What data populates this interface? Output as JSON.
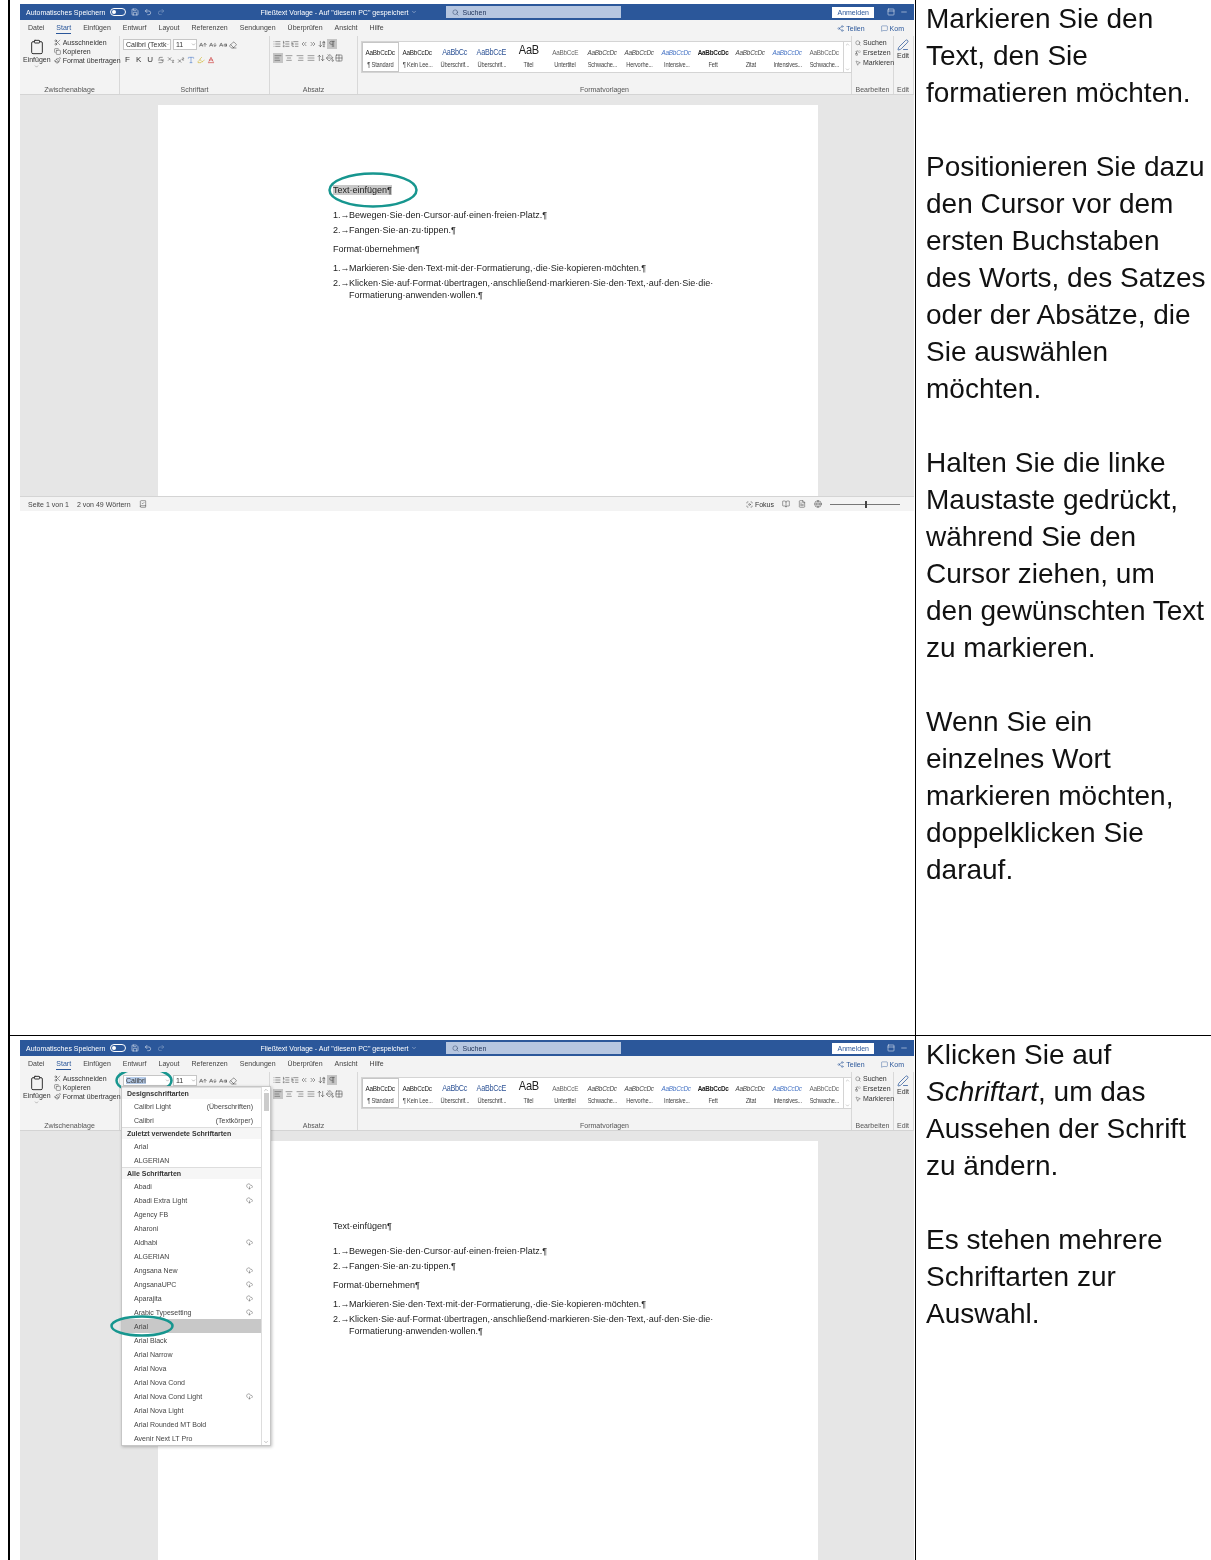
{
  "rows": [
    {
      "screenshot": {
        "title_bar": {
          "autosave_label": "Automatisches Speichern",
          "autosave_on": false,
          "document_title": "Fließtext Vorlage - Auf \"diesem PC\" gespeichert",
          "search_placeholder": "Suchen",
          "sign_in": "Anmelden"
        },
        "tabs": [
          {
            "label": "Datei",
            "selected": false
          },
          {
            "label": "Start",
            "selected": true
          },
          {
            "label": "Einfügen",
            "selected": false
          },
          {
            "label": "Entwurf",
            "selected": false
          },
          {
            "label": "Layout",
            "selected": false
          },
          {
            "label": "Referenzen",
            "selected": false
          },
          {
            "label": "Sendungen",
            "selected": false
          },
          {
            "label": "Überprüfen",
            "selected": false
          },
          {
            "label": "Ansicht",
            "selected": false
          },
          {
            "label": "Hilfe",
            "selected": false
          }
        ],
        "share_label": "Teilen",
        "comments_label": "Kom",
        "clipboard": {
          "paste": "Einfügen",
          "cut": "Ausschneiden",
          "copy": "Kopieren",
          "format_painter": "Format übertragen",
          "group": "Zwischenablage"
        },
        "font": {
          "name": "Calibri (Textk",
          "name_selected": false,
          "circled": false,
          "size": "11",
          "buttons": [
            "F",
            "K",
            "U"
          ],
          "group": "Schriftart"
        },
        "paragraph": {
          "show_marks": true,
          "alignments": [
            {
              "kind": "left",
              "selected": true
            },
            {
              "kind": "center",
              "selected": false
            },
            {
              "kind": "right",
              "selected": false
            },
            {
              "kind": "justify",
              "selected": false
            }
          ],
          "group": "Absatz"
        },
        "styles": {
          "group": "Formatvorlagen",
          "items": [
            {
              "preview": "AaBbCcDc",
              "name": "¶ Standard",
              "kind": "normal",
              "selected": true
            },
            {
              "preview": "AaBbCcDc",
              "name": "¶ Kein Lee...",
              "kind": "normal",
              "selected": false
            },
            {
              "preview": "AaBbCc",
              "name": "Überschrif...",
              "kind": "heading",
              "selected": false
            },
            {
              "preview": "AaBbCcE",
              "name": "Überschrif...",
              "kind": "heading",
              "selected": false
            },
            {
              "preview": "AaB",
              "name": "Titel",
              "kind": "title",
              "selected": false
            },
            {
              "preview": "AaBbCcE",
              "name": "Untertitel",
              "kind": "subtle",
              "selected": false
            },
            {
              "preview": "AaBbCcDc",
              "name": "Schwache...",
              "kind": "emphasis",
              "selected": false
            },
            {
              "preview": "AaBbCcDc",
              "name": "Hervorhe...",
              "kind": "emphasis",
              "selected": false
            },
            {
              "preview": "AaBbCcDc",
              "name": "Intensive...",
              "kind": "intense",
              "selected": false
            },
            {
              "preview": "AaBbCcDc",
              "name": "Fett",
              "kind": "strong",
              "selected": false
            },
            {
              "preview": "AaBbCcDc",
              "name": "Zitat",
              "kind": "emphasis",
              "selected": false
            },
            {
              "preview": "AaBbCcDc",
              "name": "Intensives...",
              "kind": "intense",
              "selected": false
            },
            {
              "preview": "AaBbCcDc",
              "name": "Schwache...",
              "kind": "subtle",
              "selected": false
            }
          ]
        },
        "editing": {
          "find": "Suchen",
          "replace": "Ersetzen",
          "select": "Markieren",
          "group": "Bearbeiten"
        },
        "editor": {
          "label": "Edit",
          "group": "Edit"
        },
        "document": {
          "heading": {
            "text": "Text·einfügen¶",
            "selected": true,
            "circled": true
          },
          "list_1": [
            {
              "number": "1.→",
              "text": "Bewegen·Sie·den·Cursor·auf·einen·freien·Platz.¶"
            },
            {
              "number": "2.→",
              "text": "Fangen·Sie·an·zu·tippen.¶"
            }
          ],
          "subheading": "Format·übernehmen¶",
          "list_2": [
            {
              "number": "1.→",
              "text": "Markieren·Sie·den·Text·mit·der·Formatierung,·die·Sie·kopieren·möchten.¶"
            },
            {
              "number": "2.→",
              "text": "Klicken·Sie·auf·Format·übertragen,·anschließend·markieren·Sie·den·Text,·auf·den·Sie·die·Formatierung·anwenden·wollen.¶"
            }
          ]
        },
        "status_bar": {
          "page": "Seite 1 von 1",
          "words": "2 von 49 Wörtern",
          "focus": "Fokus",
          "zoom": {
            "level": 0.5
          }
        }
      },
      "instructions": [
        "Markieren Sie den Text, den Sie formatieren möchten.",
        "Positionieren Sie dazu den Cursor vor dem ersten Buchstaben des Worts, des Satzes oder der Absätze, die Sie auswählen möchten.",
        "Halten Sie die linke Maustaste gedrückt, während Sie den Cursor ziehen, um den gewünschten Text zu markieren.",
        "Wenn Sie ein einzelnes Wort markieren möchten, doppelklicken Sie darauf."
      ]
    },
    {
      "screenshot": {
        "title_bar": {
          "autosave_label": "Automatisches Speichern",
          "autosave_on": false,
          "document_title": "Fließtext Vorlage - Auf \"diesem PC\" gespeichert",
          "search_placeholder": "Suchen",
          "sign_in": "Anmelden"
        },
        "tabs": [
          {
            "label": "Datei",
            "selected": false
          },
          {
            "label": "Start",
            "selected": true
          },
          {
            "label": "Einfügen",
            "selected": false
          },
          {
            "label": "Entwurf",
            "selected": false
          },
          {
            "label": "Layout",
            "selected": false
          },
          {
            "label": "Referenzen",
            "selected": false
          },
          {
            "label": "Sendungen",
            "selected": false
          },
          {
            "label": "Überprüfen",
            "selected": false
          },
          {
            "label": "Ansicht",
            "selected": false
          },
          {
            "label": "Hilfe",
            "selected": false
          }
        ],
        "share_label": "Teilen",
        "comments_label": "Kom",
        "clipboard": {
          "paste": "Einfügen",
          "cut": "Ausschneiden",
          "copy": "Kopieren",
          "format_painter": "Format übertragen",
          "group": "Zwischenablage"
        },
        "font": {
          "name": "Calibri",
          "name_selected": true,
          "circled": true,
          "size": "11"
        },
        "paragraph": {
          "show_marks": true,
          "alignments": [
            {
              "kind": "left",
              "selected": true
            },
            {
              "kind": "center",
              "selected": false
            },
            {
              "kind": "right",
              "selected": false
            },
            {
              "kind": "justify",
              "selected": false
            }
          ],
          "group": "Absatz"
        },
        "styles": {
          "group": "Formatvorlagen",
          "items": [
            {
              "preview": "AaBbCcDc",
              "name": "¶ Standard",
              "kind": "normal",
              "selected": true
            },
            {
              "preview": "AaBbCcDc",
              "name": "¶ Kein Lee...",
              "kind": "normal",
              "selected": false
            },
            {
              "preview": "AaBbCc",
              "name": "Überschrif...",
              "kind": "heading",
              "selected": false
            },
            {
              "preview": "AaBbCcE",
              "name": "Überschrif...",
              "kind": "heading",
              "selected": false
            },
            {
              "preview": "AaB",
              "name": "Titel",
              "kind": "title",
              "selected": false
            },
            {
              "preview": "AaBbCcE",
              "name": "Untertitel",
              "kind": "subtle",
              "selected": false
            },
            {
              "preview": "AaBbCcDc",
              "name": "Schwache...",
              "kind": "emphasis",
              "selected": false
            },
            {
              "preview": "AaBbCcDc",
              "name": "Hervorhe...",
              "kind": "emphasis",
              "selected": false
            },
            {
              "preview": "AaBbCcDc",
              "name": "Intensive...",
              "kind": "intense",
              "selected": false
            },
            {
              "preview": "AaBbCcDc",
              "name": "Fett",
              "kind": "strong",
              "selected": false
            },
            {
              "preview": "AaBbCcDc",
              "name": "Zitat",
              "kind": "emphasis",
              "selected": false
            },
            {
              "preview": "AaBbCcDc",
              "name": "Intensives...",
              "kind": "intense",
              "selected": false
            },
            {
              "preview": "AaBbCcDc",
              "name": "Schwache...",
              "kind": "subtle",
              "selected": false
            }
          ]
        },
        "editing": {
          "find": "Suchen",
          "replace": "Ersetzen",
          "select": "Markieren",
          "group": "Bearbeiten"
        },
        "editor": {
          "label": "Edit",
          "group": "Edit"
        },
        "font_dropdown": {
          "sections": [
            {
              "title": "Designschriftarten",
              "items": [
                {
                  "name": "Calibri Light",
                  "note": "(Überschriften)",
                  "cloud": false,
                  "selected": false,
                  "circled": false
                },
                {
                  "name": "Calibri",
                  "note": "(Textkörper)",
                  "cloud": false,
                  "selected": false,
                  "circled": false
                }
              ]
            },
            {
              "title": "Zuletzt verwendete Schriftarten",
              "items": [
                {
                  "name": "Arial",
                  "cloud": false,
                  "selected": false,
                  "circled": false
                },
                {
                  "name": "ALGERIAN",
                  "cloud": false,
                  "selected": false,
                  "circled": false
                }
              ]
            },
            {
              "title": "Alle Schriftarten",
              "items": [
                {
                  "name": "Abadi",
                  "cloud": true,
                  "selected": false,
                  "circled": false
                },
                {
                  "name": "Abadi Extra Light",
                  "cloud": true,
                  "selected": false,
                  "circled": false
                },
                {
                  "name": "Agency FB",
                  "cloud": false,
                  "selected": false,
                  "circled": false
                },
                {
                  "name": "Aharoni",
                  "cloud": false,
                  "selected": false,
                  "circled": false
                },
                {
                  "name": "Aldhabi",
                  "cloud": true,
                  "selected": false,
                  "circled": false
                },
                {
                  "name": "ALGERIAN",
                  "cloud": false,
                  "selected": false,
                  "circled": false
                },
                {
                  "name": "Angsana New",
                  "cloud": true,
                  "selected": false,
                  "circled": false
                },
                {
                  "name": "AngsanaUPC",
                  "cloud": true,
                  "selected": false,
                  "circled": false
                },
                {
                  "name": "Aparajita",
                  "cloud": true,
                  "selected": false,
                  "circled": false
                },
                {
                  "name": "Arabic Typesetting",
                  "cloud": true,
                  "selected": false,
                  "circled": false
                },
                {
                  "name": "Arial",
                  "cloud": false,
                  "selected": true,
                  "circled": true
                },
                {
                  "name": "Arial Black",
                  "cloud": false,
                  "selected": false,
                  "circled": false
                },
                {
                  "name": "Arial Narrow",
                  "cloud": false,
                  "selected": false,
                  "circled": false
                },
                {
                  "name": "Arial Nova",
                  "cloud": false,
                  "selected": false,
                  "circled": false
                },
                {
                  "name": "Arial Nova Cond",
                  "cloud": false,
                  "selected": false,
                  "circled": false
                },
                {
                  "name": "Arial Nova Cond Light",
                  "cloud": true,
                  "selected": false,
                  "circled": false
                },
                {
                  "name": "Arial Nova Light",
                  "cloud": false,
                  "selected": false,
                  "circled": false
                },
                {
                  "name": "Arial Rounded MT Bold",
                  "cloud": false,
                  "selected": false,
                  "circled": false
                },
                {
                  "name": "Avenir Next LT Pro",
                  "cloud": false,
                  "selected": false,
                  "circled": false
                }
              ]
            }
          ]
        },
        "document": {
          "heading": {
            "text": "Text·einfügen¶",
            "selected": false,
            "circled": false
          },
          "list_1": [
            {
              "number": "1.→",
              "text": "Bewegen·Sie·den·Cursor·auf·einen·freien·Platz.¶"
            },
            {
              "number": "2.→",
              "text": "Fangen·Sie·an·zu·tippen.¶"
            }
          ],
          "subheading": "Format·übernehmen¶",
          "list_2": [
            {
              "number": "1.→",
              "text": "Markieren·Sie·den·Text·mit·der·Formatierung,·die·Sie·kopieren·möchten.¶"
            },
            {
              "number": "2.→",
              "text": "Klicken·Sie·auf·Format·übertragen,·anschließend·markieren·Sie·den·Text,·auf·den·Sie·die·Formatierung·anwenden·wollen.¶"
            }
          ]
        }
      },
      "instructions": [
        "Klicken Sie auf *Schriftart*, um das Aussehen der Schrift zu ändern.",
        "Es stehen mehrere Schriftarten zur Auswahl."
      ]
    }
  ]
}
